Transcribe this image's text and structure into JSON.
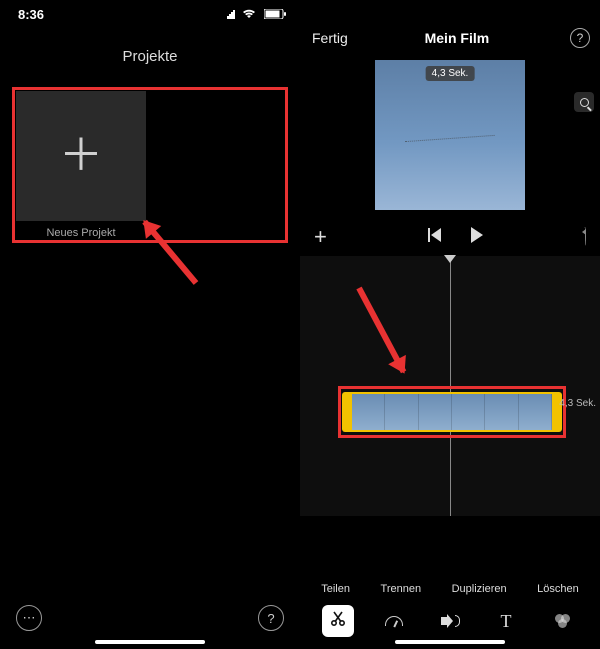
{
  "status": {
    "time": "8:36"
  },
  "left": {
    "title": "Projekte",
    "new_project_label": "Neues Projekt"
  },
  "right": {
    "done": "Fertig",
    "title": "Mein Film",
    "duration_badge": "4,3 Sek.",
    "timeline_duration": "4,3 Sek.",
    "actions": {
      "share": "Teilen",
      "split": "Trennen",
      "duplicate": "Duplizieren",
      "delete": "Löschen"
    },
    "tool_text": "T"
  }
}
